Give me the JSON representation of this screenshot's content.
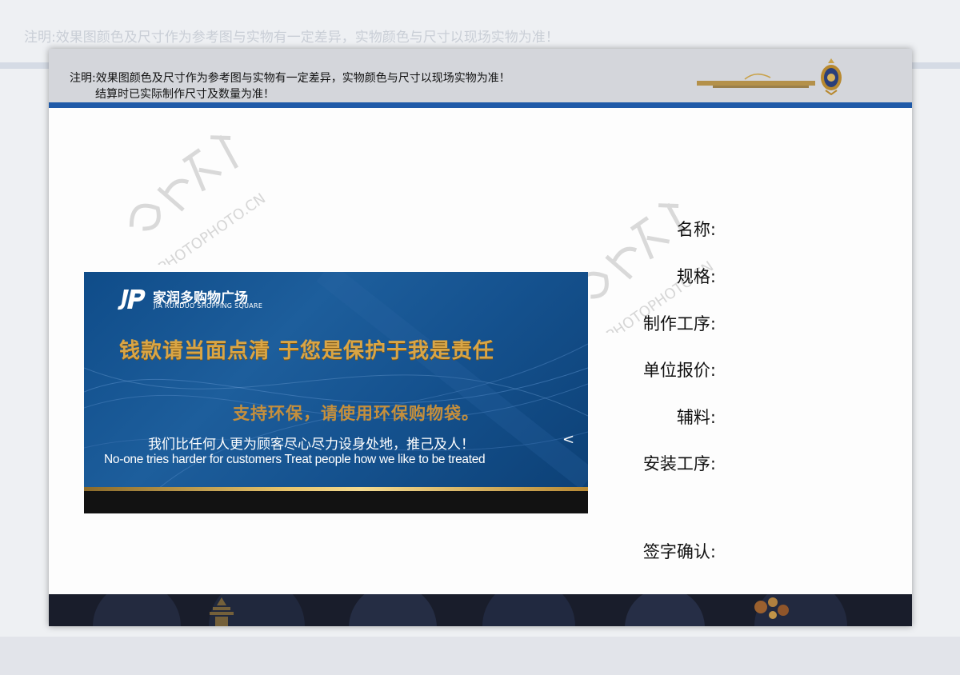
{
  "background": {
    "note_line_1": "注明:效果图颜色及尺寸作为参考图与实物有一定差异，实物颜色与尺寸以现场实物为准！"
  },
  "header": {
    "note_line_1": "注明:效果图颜色及尺寸作为参考图与实物有一定差异，实物颜色与尺寸以现场实物为准！",
    "note_line_2": "结算时已实际制作尺寸及数量为准！",
    "accent_color": "#1f5aa8",
    "logo_icon": "studio-emblem-icon"
  },
  "sign": {
    "logo_cn": "家润多购物广场",
    "logo_en": "JIA RUNDUO SHOPPING SQUARE",
    "logo_icon": "jrd-logo-icon",
    "headline": "钱款请当面点清  于您是保护于我是责任",
    "subheadline": "支持环保，请使用环保购物袋。",
    "slogan_cn": "我们比任何人更为顾客尽心尽力设身处地，推己及人！",
    "slogan_en": "No-one tries harder for customers Treat people how we like to be treated",
    "chevron": "<",
    "background_color": "#15528f",
    "headline_color": "#d9a545",
    "subheadline_color": "#c58f3c"
  },
  "specs": {
    "name_label": "名称:",
    "size_label": "规格:",
    "process_label": "制作工序:",
    "price_label": "单位报价:",
    "material_label": "辅料:",
    "install_label": "安装工序:",
    "sign_label": "签字确认:"
  },
  "watermark": {
    "icon": "photophoto-watermark-icon"
  }
}
